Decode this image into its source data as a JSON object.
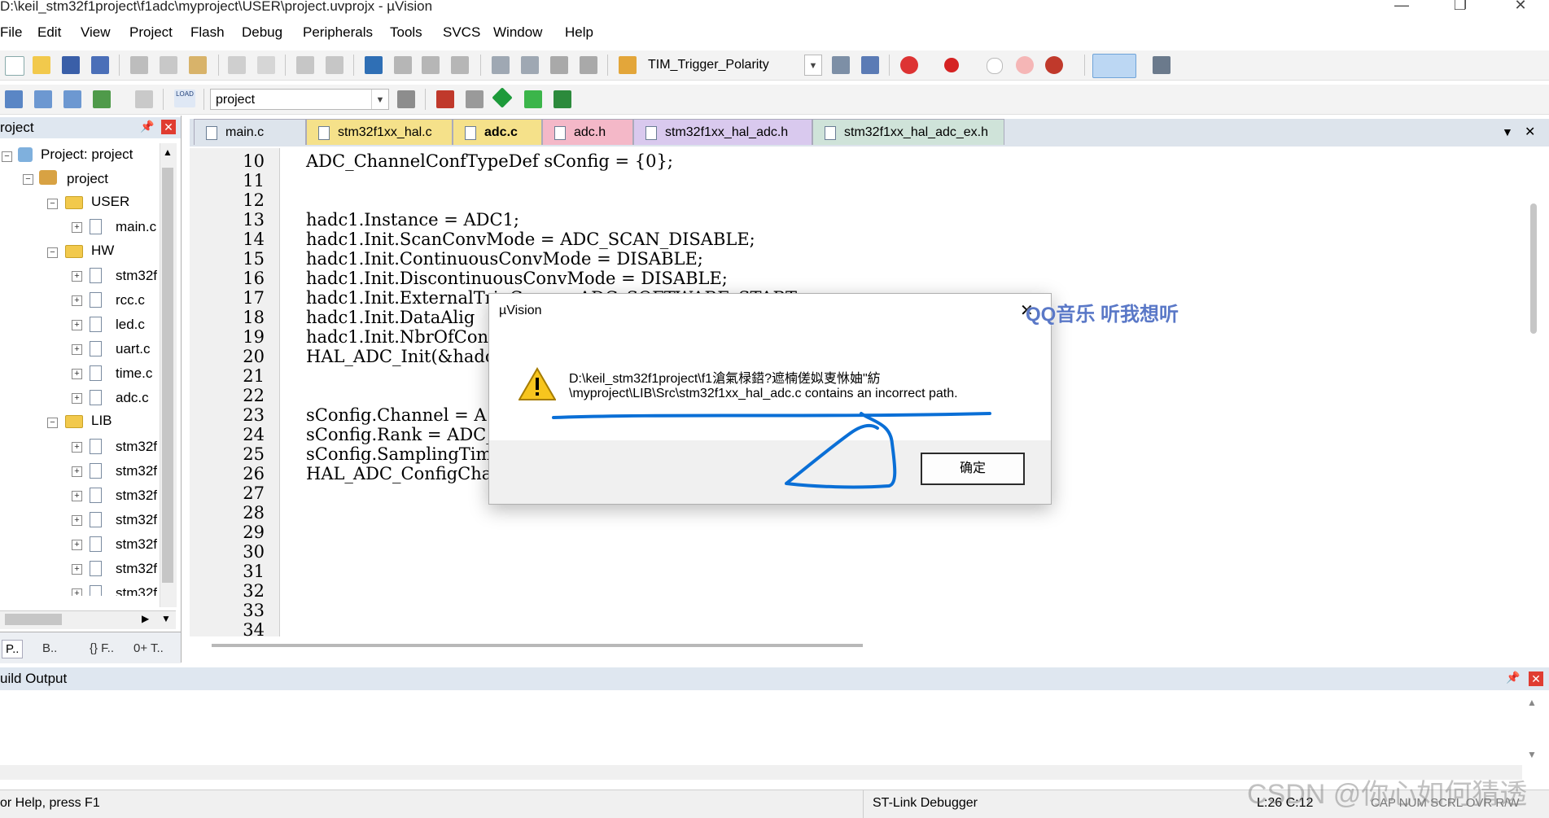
{
  "window": {
    "title": "D:\\keil_stm32f1project\\f1adc\\myproject\\USER\\project.uvprojx - µVision",
    "minimize": "—",
    "maximize": "❐",
    "close": "✕"
  },
  "menu": [
    "File",
    "Edit",
    "View",
    "Project",
    "Flash",
    "Debug",
    "Peripherals",
    "Tools",
    "SVCS",
    "Window",
    "Help"
  ],
  "toolbar1": {
    "combo_value": "TIM_Trigger_Polarity"
  },
  "toolbar2": {
    "combo_value": "project",
    "load_label": "LOAD"
  },
  "project_pane": {
    "header": "roject",
    "root": "Project: project",
    "target": "project",
    "groups": [
      {
        "name": "USER",
        "files": [
          "main.c"
        ]
      },
      {
        "name": "HW",
        "files": [
          "stm32f",
          "rcc.c",
          "led.c",
          "uart.c",
          "time.c",
          "adc.c"
        ]
      },
      {
        "name": "LIB",
        "files": [
          "stm32f",
          "stm32f",
          "stm32f",
          "stm32f",
          "stm32f",
          "stm32f",
          "stm32f"
        ]
      }
    ],
    "bottom_tabs": [
      "P..",
      "B..",
      "{} F..",
      "0+ T.."
    ]
  },
  "editor": {
    "tabs": [
      {
        "label": "main.c",
        "color": "#dde4ec"
      },
      {
        "label": "stm32f1xx_hal.c",
        "color": "#f5e18a"
      },
      {
        "label": "adc.c",
        "color": "#f5e18a"
      },
      {
        "label": "adc.h",
        "color": "#f4b8c8"
      },
      {
        "label": "stm32f1xx_hal_adc.h",
        "color": "#d9c9ee"
      },
      {
        "label": "stm32f1xx_hal_adc_ex.h",
        "color": "#cfe3d9"
      }
    ],
    "tab_menu": "▼",
    "tab_close": "✕",
    "lines": [
      {
        "n": "10",
        "code": "ADC_ChannelConfTypeDef sConfig = {0};"
      },
      {
        "n": "11",
        "code": ""
      },
      {
        "n": "12",
        "code": ""
      },
      {
        "n": "13",
        "code": "hadc1.Instance = ADC1;"
      },
      {
        "n": "14",
        "code": "hadc1.Init.ScanConvMode = ADC_SCAN_DISABLE;"
      },
      {
        "n": "15",
        "code": "hadc1.Init.ContinuousConvMode = DISABLE;"
      },
      {
        "n": "16",
        "code": "hadc1.Init.DiscontinuousConvMode = DISABLE;"
      },
      {
        "n": "17",
        "code": "hadc1.Init.ExternalTrigConv = ADC_SOFTWARE_START;"
      },
      {
        "n": "18",
        "code": "hadc1.Init.DataAlig"
      },
      {
        "n": "19",
        "code": "hadc1.Init.NbrOfCon"
      },
      {
        "n": "20",
        "code": "HAL_ADC_Init(&hadc1"
      },
      {
        "n": "21",
        "code": ""
      },
      {
        "n": "22",
        "code": ""
      },
      {
        "n": "23",
        "code": "sConfig.Channel = A"
      },
      {
        "n": "24",
        "code": "sConfig.Rank = ADC_"
      },
      {
        "n": "25",
        "code": "sConfig.SamplingTim"
      },
      {
        "n": "26",
        "code": "HAL_ADC_ConfigChann"
      },
      {
        "n": "27",
        "code": ""
      },
      {
        "n": "28",
        "code": ""
      },
      {
        "n": "29",
        "code": ""
      },
      {
        "n": "30",
        "code": ""
      },
      {
        "n": "31",
        "code": ""
      },
      {
        "n": "32",
        "code": ""
      },
      {
        "n": "33",
        "code": ""
      },
      {
        "n": "34",
        "code": ""
      }
    ]
  },
  "dialog": {
    "title": "µVision",
    "message_line1": "D:\\keil_stm32f1project\\f1滄氣椂鍣?遮楠傞姒叓恘妯\"紡",
    "message_line2": "\\myproject\\LIB\\Src\\stm32f1xx_hal_adc.c contains an incorrect path.",
    "ok_label": "确定",
    "close": "✕"
  },
  "overlay_text": "QQ音乐 听我想听",
  "build_output": {
    "header": "uild Output",
    "pin": "📌",
    "close": "✕"
  },
  "statusbar": {
    "help": "or Help, press F1",
    "debugger": "ST-Link Debugger",
    "position": "L:26 C:12",
    "indicators": "CAP NUM SCRL OVR R/W"
  },
  "watermark": "CSDN @你心如何猜透",
  "colors": {
    "close_red": "#e03c31",
    "ink_blue": "#0a6fd6",
    "warning_yellow": "#f7c51e"
  }
}
